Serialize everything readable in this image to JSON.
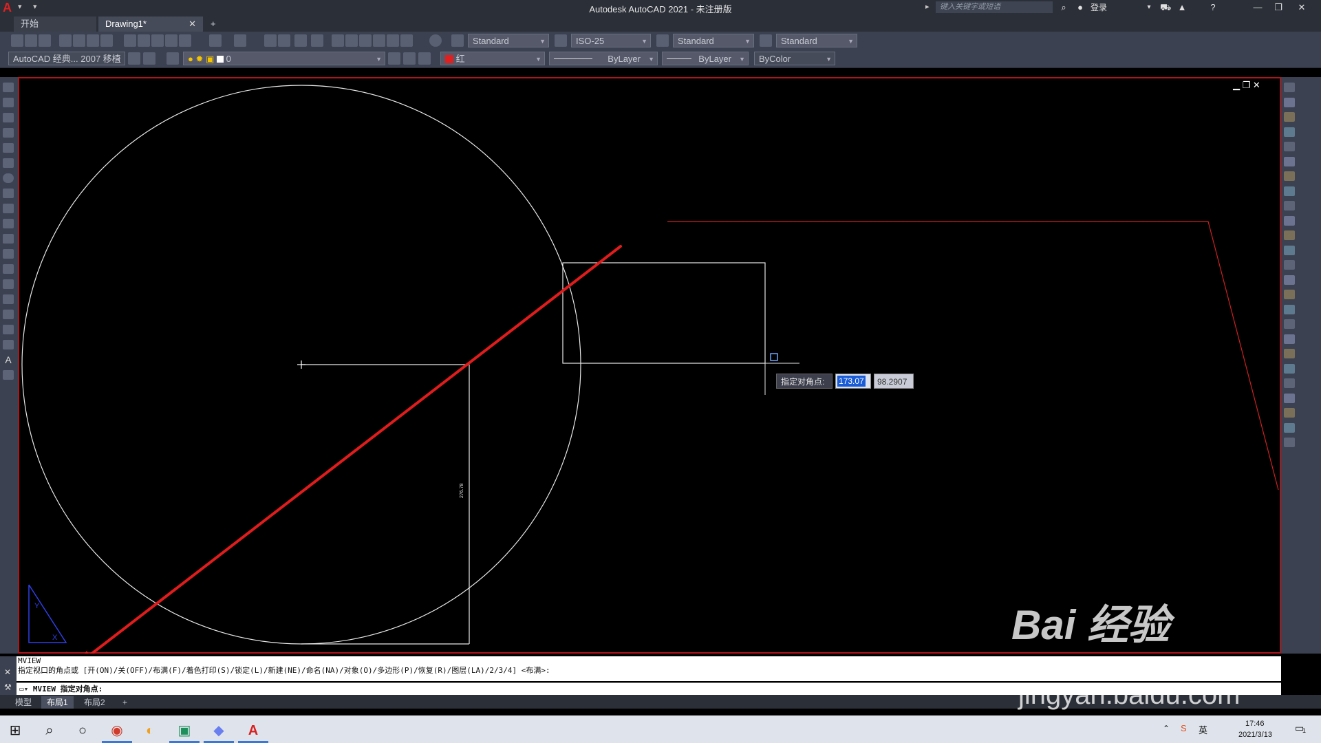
{
  "app": {
    "title": "Autodesk AutoCAD 2021 - 未注册版",
    "logo_letter": "A",
    "search_placeholder": "键入关键字或短语",
    "login_label": "登录"
  },
  "file_tabs": [
    {
      "label": "开始"
    },
    {
      "label": "Drawing1*"
    }
  ],
  "file_tab_close": "✕",
  "file_tab_add": "+",
  "toolbar1": {
    "text_style": "Standard",
    "dim_style": "ISO-25",
    "table_style": "Standard",
    "mleader_style": "Standard"
  },
  "toolbar2": {
    "workspace": "AutoCAD 经典... 2007 移植",
    "layer": "0",
    "color": "红",
    "linetype": "ByLayer",
    "lineweight": "ByLayer",
    "plotstyle": "ByColor"
  },
  "colors": {
    "accent_red": "#e02020",
    "viewport_border": "#b0151a",
    "highlight_blue": "#1a5bd6"
  },
  "dynamic_input": {
    "prompt": "指定对角点:",
    "x_value": "173.07",
    "y_value": "98.2907"
  },
  "dimension_text": "276.78",
  "command_line": {
    "history": [
      "MVIEW",
      "指定视口的角点或 [开(ON)/关(OFF)/布满(F)/着色打印(S)/锁定(L)/新建(NE)/命名(NA)/对象(O)/多边形(P)/恢复(R)/图层(LA)/2/3/4] <布满>:"
    ],
    "prompt": "MVIEW 指定对角点:"
  },
  "layout_tabs": [
    {
      "label": "模型"
    },
    {
      "label": "布局1"
    },
    {
      "label": "布局2"
    }
  ],
  "layout_tab_add": "+",
  "taskbar": {
    "time": "17:46",
    "date": "2021/3/13",
    "ime": "英",
    "notifications": "1"
  },
  "watermark": {
    "brand": "Bai 经验",
    "url": "jingyan.baidu.com"
  },
  "icons": [
    "windows-start-icon",
    "search-icon",
    "cortana-icon",
    "chrome-icon",
    "app-icon",
    "app-icon",
    "app-icon",
    "autocad-icon"
  ]
}
